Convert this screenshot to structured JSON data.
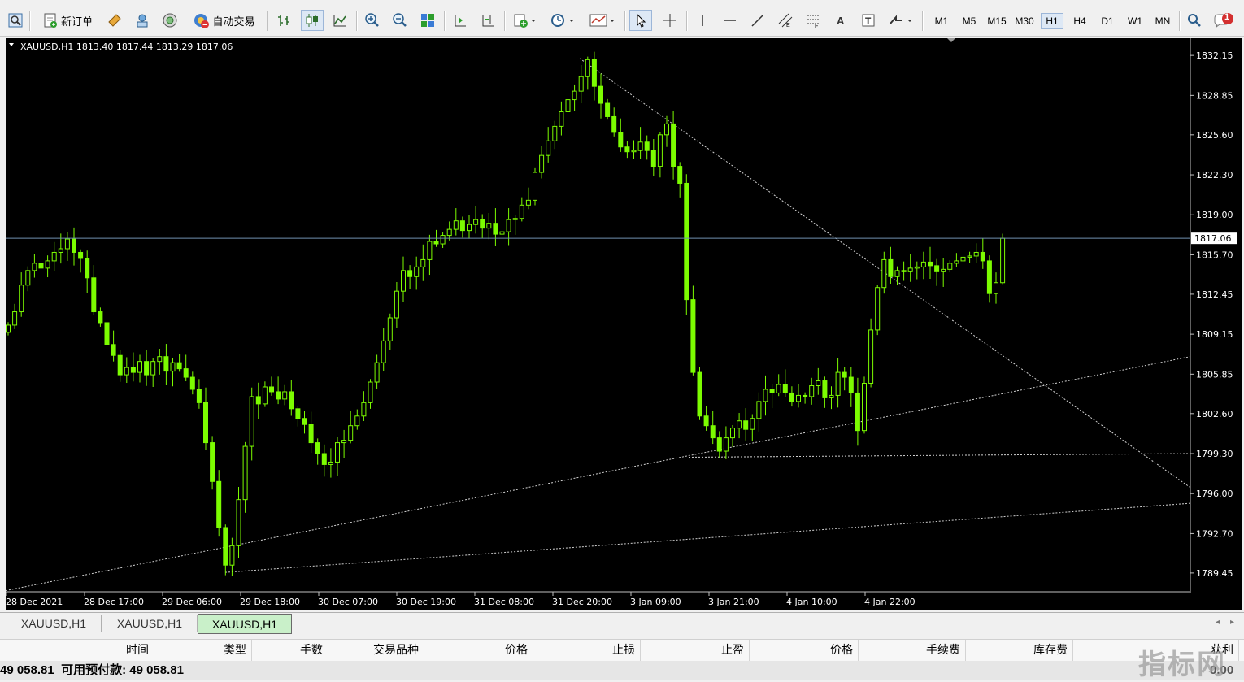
{
  "toolbar": {
    "new_order_label": "新订单",
    "auto_trade_label": "自动交易",
    "timeframes": [
      "M1",
      "M5",
      "M15",
      "M30",
      "H1",
      "H4",
      "D1",
      "W1",
      "MN"
    ],
    "active_timeframe": "H1",
    "notification_count": "1"
  },
  "chart": {
    "info": "XAUUSD,H1  1813.40 1817.44 1813.29 1817.06",
    "current_price": "1817.06",
    "price_ticks": [
      "1832.15",
      "1828.85",
      "1825.60",
      "1822.30",
      "1819.00",
      "1815.70",
      "1812.45",
      "1809.15",
      "1805.85",
      "1802.60",
      "1799.30",
      "1796.00",
      "1792.70",
      "1789.45"
    ],
    "time_ticks": [
      "28 Dec 2021",
      "28 Dec 17:00",
      "29 Dec 06:00",
      "29 Dec 18:00",
      "30 Dec 07:00",
      "30 Dec 19:00",
      "31 Dec 08:00",
      "31 Dec 20:00",
      "3 Jan 09:00",
      "3 Jan 21:00",
      "4 Jan 10:00",
      "4 Jan 22:00"
    ],
    "colors": {
      "background": "#000000",
      "candle": "#7CFC00",
      "price_line": "#7090B0",
      "trendline": "#D0D0D0"
    }
  },
  "chart_data": {
    "type": "candlestick",
    "symbol": "XAUUSD",
    "timeframe": "H1",
    "last": {
      "open": 1813.4,
      "high": 1817.44,
      "low": 1813.29,
      "close": 1817.06
    },
    "ylim": [
      1787.9,
      1833.3
    ],
    "close_path": [
      1809.9,
      1811.0,
      1813.2,
      1814.4,
      1815.0,
      1814.6,
      1815.2,
      1815.9,
      1816.2,
      1817.0,
      1815.9,
      1815.4,
      1813.8,
      1811.0,
      1810.1,
      1808.3,
      1807.4,
      1805.8,
      1806.4,
      1806.0,
      1806.9,
      1805.8,
      1806.9,
      1807.3,
      1806.1,
      1806.8,
      1806.3,
      1805.6,
      1804.6,
      1803.5,
      1800.2,
      1797.0,
      1793.2,
      1790.1,
      1791.7,
      1795.5,
      1799.9,
      1804.0,
      1803.4,
      1804.8,
      1804.4,
      1803.8,
      1804.4,
      1803.0,
      1802.2,
      1801.7,
      1800.2,
      1799.3,
      1798.4,
      1798.6,
      1800.2,
      1800.4,
      1801.6,
      1802.4,
      1803.5,
      1805.2,
      1806.8,
      1808.6,
      1810.5,
      1812.7,
      1814.4,
      1813.9,
      1814.7,
      1815.3,
      1816.8,
      1816.6,
      1817.3,
      1817.8,
      1818.5,
      1817.7,
      1818.2,
      1818.6,
      1817.9,
      1818.3,
      1817.4,
      1817.6,
      1818.6,
      1818.7,
      1819.8,
      1820.2,
      1822.5,
      1823.9,
      1825.1,
      1826.3,
      1827.5,
      1828.5,
      1829.2,
      1830.4,
      1831.8,
      1829.6,
      1828.2,
      1827.1,
      1825.8,
      1824.6,
      1824.2,
      1824.3,
      1825.0,
      1824.3,
      1823.0,
      1825.6,
      1826.5,
      1823.0,
      1821.6,
      1812.0,
      1806.0,
      1802.4,
      1801.6,
      1800.6,
      1799.5,
      1800.6,
      1801.4,
      1802.0,
      1801.3,
      1802.2,
      1803.6,
      1804.6,
      1804.3,
      1805.0,
      1804.3,
      1803.6,
      1804.1,
      1804.0,
      1804.9,
      1805.3,
      1803.9,
      1804.1,
      1806.0,
      1805.6,
      1804.3,
      1801.2,
      1805.1,
      1809.5,
      1813.0,
      1815.3,
      1813.9,
      1814.4,
      1814.3,
      1814.6,
      1814.7,
      1815.1,
      1814.8,
      1814.3,
      1814.5,
      1815.0,
      1815.2,
      1815.5,
      1815.6,
      1815.9,
      1815.2,
      1812.5,
      1813.4,
      1817.06
    ]
  },
  "tabs": [
    "XAUUSD,H1",
    "XAUUSD,H1",
    "XAUUSD,H1"
  ],
  "active_tab": 2,
  "columns": [
    "时间",
    "类型",
    "手数",
    "交易品种",
    "价格",
    "止损",
    "止盈",
    "价格",
    "手续费",
    "库存费",
    "获利"
  ],
  "status": {
    "text": "49 058.81  可用预付款: 49 058.81",
    "right": "0.00"
  },
  "watermark": "指标网"
}
